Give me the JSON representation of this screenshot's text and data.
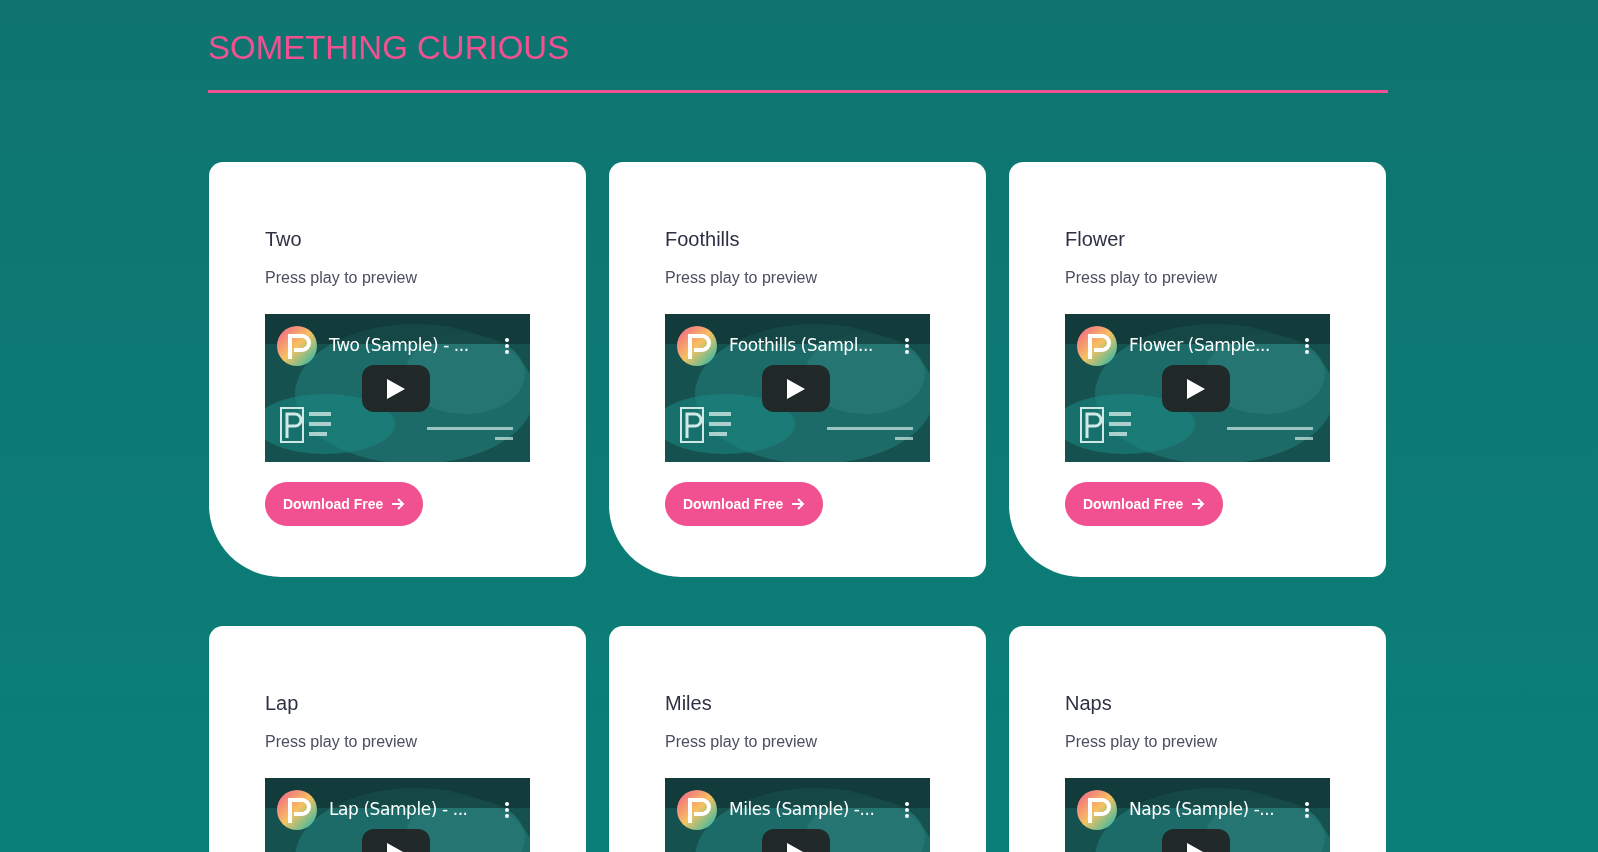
{
  "section": {
    "title": "SOMETHING CURIOUS"
  },
  "cards": [
    {
      "title": "Two",
      "subtitle": "Press play to preview",
      "video": {
        "title": "Two (Sample) - ..."
      },
      "button": "Download Free"
    },
    {
      "title": "Foothills",
      "subtitle": "Press play to preview",
      "video": {
        "title": "Foothills (Sampl..."
      },
      "button": "Download Free"
    },
    {
      "title": "Flower",
      "subtitle": "Press play to preview",
      "video": {
        "title": "Flower (Sample..."
      },
      "button": "Download Free"
    },
    {
      "title": "Lap",
      "subtitle": "Press play to preview",
      "video": {
        "title": "Lap (Sample) - ..."
      }
    },
    {
      "title": "Miles",
      "subtitle": "Press play to preview",
      "video": {
        "title": "Miles (Sample) -..."
      }
    },
    {
      "title": "Naps",
      "subtitle": "Press play to preview",
      "video": {
        "title": "Naps (Sample) -..."
      }
    }
  ]
}
